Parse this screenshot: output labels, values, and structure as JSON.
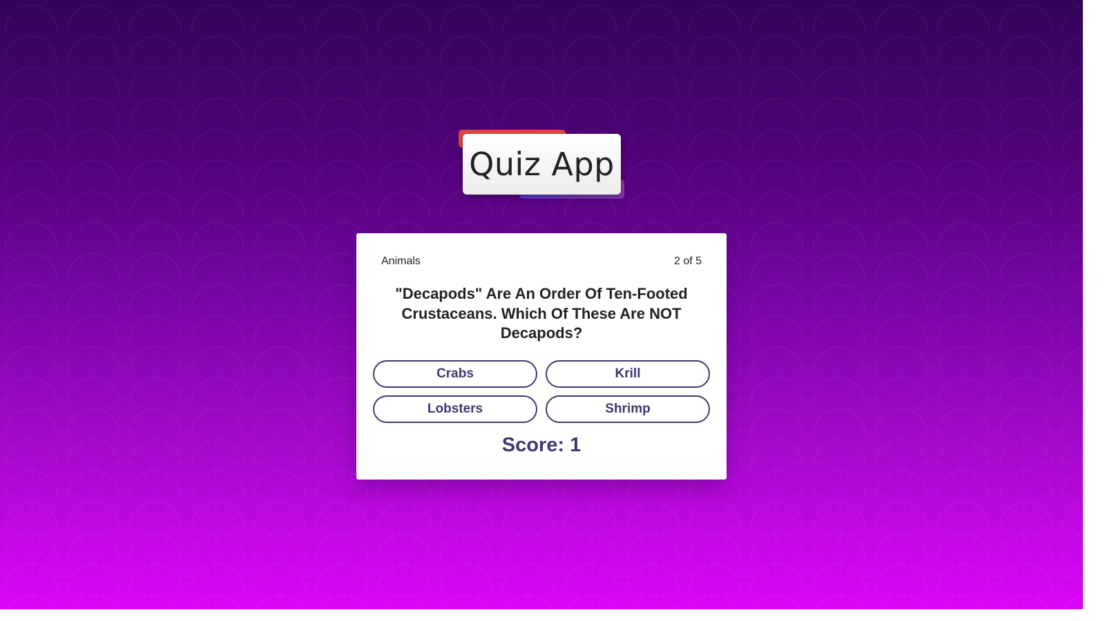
{
  "app": {
    "title": "Quiz App"
  },
  "quiz": {
    "category": "Animals",
    "progress": "2 of 5",
    "question": "\"Decapods\" Are An Order Of Ten-Footed Crustaceans. Which Of These Are NOT Decapods?",
    "answers": [
      "Crabs",
      "Krill",
      "Lobsters",
      "Shrimp"
    ],
    "score_text": "Score: 1"
  },
  "colors": {
    "accent": "#3c3a6e",
    "background_top": "#33045a",
    "background_bottom": "#dc06f8",
    "title_deco_red": "#e2473f",
    "title_deco_purple": "#5b3bd6"
  }
}
